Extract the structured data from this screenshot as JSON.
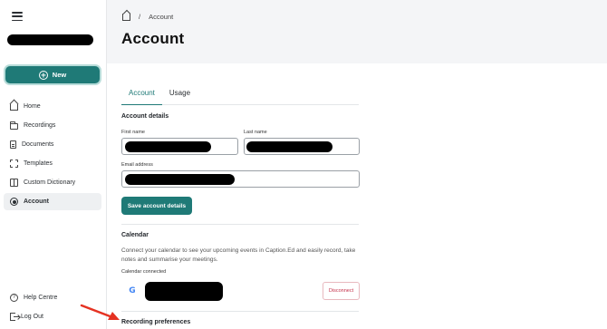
{
  "sidebar": {
    "new_label": "New",
    "items": [
      {
        "label": "Home",
        "icon": "home-icon"
      },
      {
        "label": "Recordings",
        "icon": "folder-icon"
      },
      {
        "label": "Documents",
        "icon": "document-icon"
      },
      {
        "label": "Templates",
        "icon": "template-icon"
      },
      {
        "label": "Custom Dictionary",
        "icon": "book-icon"
      },
      {
        "label": "Account",
        "icon": "account-icon",
        "active": true
      }
    ],
    "bottom_items": [
      {
        "label": "Help Centre",
        "icon": "help-icon"
      },
      {
        "label": "Log Out",
        "icon": "logout-icon"
      }
    ]
  },
  "header": {
    "breadcrumb_separator": "/",
    "breadcrumb_current": "Account",
    "title": "Account"
  },
  "tabs": [
    {
      "label": "Account",
      "active": true
    },
    {
      "label": "Usage",
      "active": false
    }
  ],
  "account_details": {
    "title": "Account details",
    "first_name_label": "First name",
    "last_name_label": "Last name",
    "email_label": "Email address",
    "save_label": "Save account details"
  },
  "calendar": {
    "title": "Calendar",
    "description": "Connect your calendar to see your upcoming events in Caption.Ed and easily record, take notes and summarise your meetings.",
    "connected_label": "Calendar connected",
    "disconnect_label": "Disconnect"
  },
  "recording": {
    "title": "Recording preferences"
  },
  "colors": {
    "accent": "#1f7a77",
    "header_bg": "#f4f5f7",
    "danger": "#c4314b",
    "arrow": "#e53222"
  }
}
